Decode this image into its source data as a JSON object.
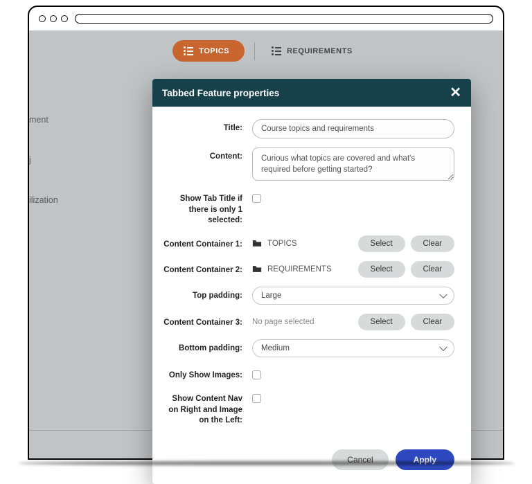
{
  "bg": {
    "tab1": "TOPICS",
    "tab2": "REQUIREMENTS",
    "side1": "ment",
    "side2": "j",
    "side3": "ilization"
  },
  "modal": {
    "title": "Tabbed Feature properties",
    "labels": {
      "title": "Title:",
      "content": "Content:",
      "showTabTitle": "Show Tab Title if there is only 1 selected:",
      "cc1": "Content Container 1:",
      "cc2": "Content Container 2:",
      "topPadding": "Top padding:",
      "cc3": "Content Container 3:",
      "bottomPadding": "Bottom padding:",
      "onlyImages": "Only Show Images:",
      "navRight": "Show Content Nav on Right and Image on the Left:"
    },
    "values": {
      "title": "Course topics and requirements",
      "content": "Curious what topics are covered and what's required before getting started?",
      "cc1": "TOPICS",
      "cc2": "REQUIREMENTS",
      "cc3": "No page selected",
      "topPadding": "Large",
      "bottomPadding": "Medium"
    },
    "buttons": {
      "select": "Select",
      "clear": "Clear",
      "cancel": "Cancel",
      "apply": "Apply"
    }
  }
}
